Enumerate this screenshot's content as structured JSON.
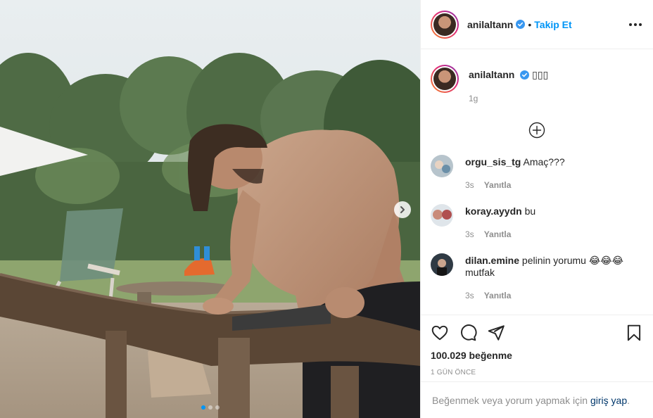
{
  "post": {
    "author": "anilaltann",
    "follow_label": "Takip Et",
    "bullet": "•",
    "caption": "▯▯▯",
    "caption_age": "1g",
    "likes": "100.029 beğenme",
    "date": "1 GÜN ÖNCE",
    "carousel": {
      "count": 3,
      "active_index": 0
    }
  },
  "comments": [
    {
      "user": "orgu_sis_tg",
      "text": "Amaç???",
      "age": "3s",
      "reply_label": "Yanıtla",
      "avatar_color": "#b7c4cc"
    },
    {
      "user": "koray.ayydn",
      "text": "bu",
      "age": "3s",
      "reply_label": "Yanıtla",
      "avatar_color": "#c98b7a"
    },
    {
      "user": "dilan.emine",
      "text": "pelinin yorumu 😂😂😂 mutfak",
      "age": "3s",
      "reply_label": "Yanıtla",
      "avatar_color": "#2f3a44"
    }
  ],
  "login": {
    "prefix": "Beğenmek veya yorum yapmak için",
    "link": "giriş yap",
    "suffix": "."
  },
  "colors": {
    "accent": "#0095f6",
    "text": "#262626",
    "muted": "#8e8e8e",
    "border": "#efefef",
    "link": "#00376b"
  },
  "icons": [
    "verified-badge-icon",
    "more-options-icon",
    "load-more-comments-icon",
    "heart-icon",
    "comment-icon",
    "share-icon",
    "bookmark-icon",
    "chevron-right-icon"
  ]
}
